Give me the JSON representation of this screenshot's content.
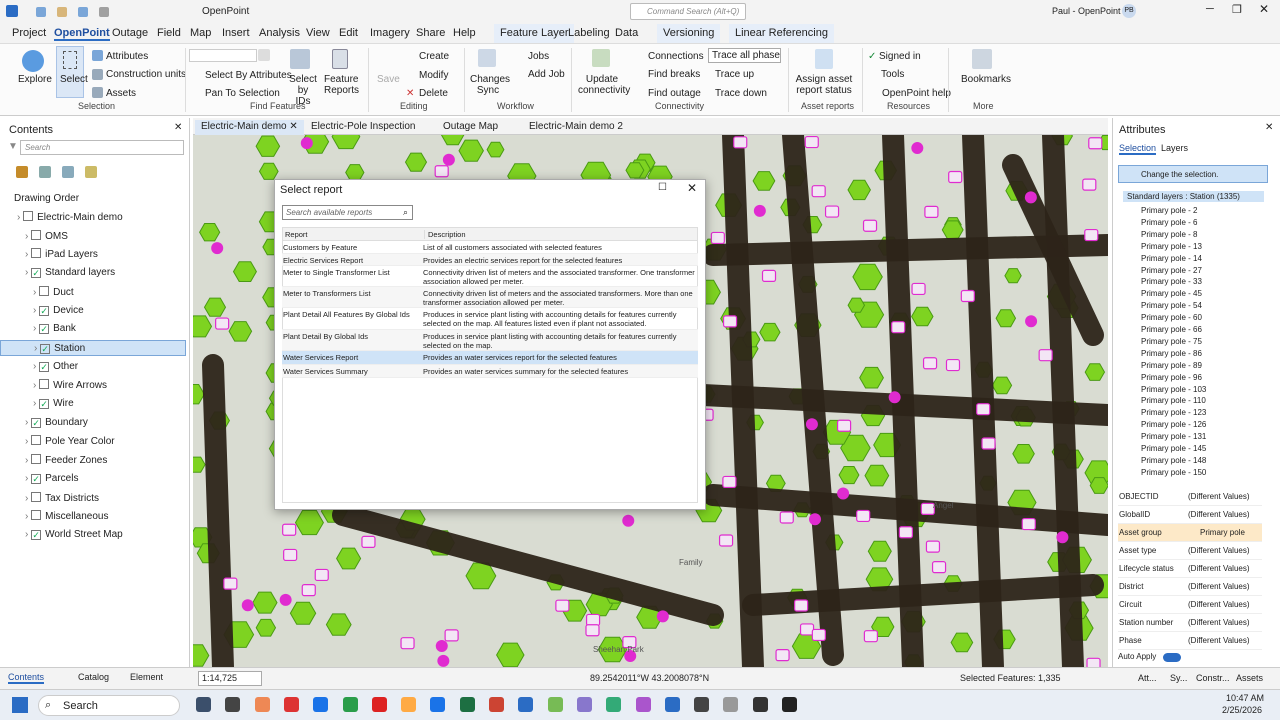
{
  "titlebar": {
    "undo_drop": "",
    "app": "OpenPoint",
    "search_placeholder": "Command Search (Alt+Q)",
    "user": "Paul - OpenPoint",
    "initials": "PB"
  },
  "menu": [
    "Project",
    "OpenPoint",
    "Outage",
    "Field",
    "Map",
    "Insert",
    "Analysis",
    "View",
    "Edit",
    "Imagery",
    "Share",
    "Help",
    "Feature Layer",
    "Labeling",
    "Data",
    "Versioning",
    "Linear Referencing"
  ],
  "ribbon": {
    "explore": "Explore",
    "select": "Select",
    "attributes": "Attributes",
    "construction_units": "Construction units",
    "assets": "Assets",
    "selection_group": "Selection",
    "select_by_attributes": "Select By Attributes",
    "pan_to_selection": "Pan To Selection",
    "select_by_ids": "Select by IDs",
    "feature_reports": "Feature Reports",
    "find_features_group": "Find Features",
    "save": "Save",
    "create": "Create",
    "modify": "Modify",
    "delete": "Delete",
    "editing_group": "Editing",
    "changes_sync": "Changes Sync",
    "jobs": "Jobs",
    "add_job": "Add Job",
    "workflow_group": "Workflow",
    "update_connectivity": "Update connectivity",
    "connections": "Connections",
    "find_breaks": "Find breaks",
    "find_outage": "Find outage",
    "trace_all_phases": "Trace all phase",
    "trace_up": "Trace up",
    "trace_down": "Trace down",
    "connectivity_group": "Connectivity",
    "assign_asset_report_status": "Assign asset report status",
    "asset_reports_group": "Asset reports",
    "signed_in": "Signed in",
    "tools": "Tools",
    "openpoint_help": "OpenPoint help",
    "resources_group": "Resources",
    "bookmarks": "Bookmarks",
    "more_group": "More"
  },
  "contents": {
    "title": "Contents",
    "search_placeholder": "Search",
    "drawing_order": "Drawing Order",
    "items": [
      {
        "label": "Electric-Main demo",
        "checked": false,
        "indent": 0
      },
      {
        "label": "OMS",
        "checked": false,
        "indent": 1
      },
      {
        "label": "iPad Layers",
        "checked": false,
        "indent": 1
      },
      {
        "label": "Standard layers",
        "checked": true,
        "indent": 1
      },
      {
        "label": "Duct",
        "checked": false,
        "indent": 2
      },
      {
        "label": "Device",
        "checked": true,
        "indent": 2
      },
      {
        "label": "Bank",
        "checked": true,
        "indent": 2
      },
      {
        "label": "Station",
        "checked": true,
        "indent": 2
      },
      {
        "label": "Other",
        "checked": true,
        "indent": 2
      },
      {
        "label": "Wire Arrows",
        "checked": false,
        "indent": 2
      },
      {
        "label": "Wire",
        "checked": true,
        "indent": 2
      },
      {
        "label": "Boundary",
        "checked": true,
        "indent": 1
      },
      {
        "label": "Pole Year Color",
        "checked": false,
        "indent": 1
      },
      {
        "label": "Feeder Zones",
        "checked": false,
        "indent": 1
      },
      {
        "label": "Parcels",
        "checked": true,
        "indent": 1
      },
      {
        "label": "Tax Districts",
        "checked": false,
        "indent": 1
      },
      {
        "label": "Miscellaneous",
        "checked": false,
        "indent": 1
      },
      {
        "label": "World Street Map",
        "checked": true,
        "indent": 1
      }
    ],
    "bottom_tabs": [
      "Contents",
      "Catalog",
      "Element"
    ]
  },
  "map_tabs": [
    "Electric-Main demo",
    "Electric-Pole Inspection",
    "Outage Map",
    "Electric-Main demo 2"
  ],
  "map_labels": [
    "Sheehan Park",
    "Family",
    "Angel"
  ],
  "dialog": {
    "title": "Select report",
    "search_placeholder": "Search available reports",
    "col_report": "Report",
    "col_description": "Description",
    "rows": [
      {
        "report": "Customers by Feature",
        "description": "List of all customers associated with selected features"
      },
      {
        "report": "Electric Services Report",
        "description": "Provides an electric services report for the selected features"
      },
      {
        "report": "Meter to Single Transformer List",
        "description": "Connectivity driven list of meters and the associated transformer. One transformer association allowed per meter."
      },
      {
        "report": "Meter to Transformers List",
        "description": "Connectivity driven list of meters and the associated transformers. More than one transformer association allowed per meter."
      },
      {
        "report": "Plant Detail All Features By Global Ids",
        "description": "Produces in service plant listing with accounting details for features currently selected on the map. All features listed even if plant not associated."
      },
      {
        "report": "Plant Detail By Global Ids",
        "description": "Produces in service plant listing with accounting details for features currently selected on the map."
      },
      {
        "report": "Water Services Report",
        "description": "Provides an water services report for the selected features"
      },
      {
        "report": "Water Services Summary",
        "description": "Provides an water services summary for the selected features"
      }
    ]
  },
  "attributes": {
    "title": "Attributes",
    "tab_selection": "Selection",
    "tab_layers": "Layers",
    "change_selection": "Change the selection.",
    "root": "Standard layers : Station (1335)",
    "poles": [
      "Primary pole - 2",
      "Primary pole - 6",
      "Primary pole - 8",
      "Primary pole - 13",
      "Primary pole - 14",
      "Primary pole - 27",
      "Primary pole - 33",
      "Primary pole - 45",
      "Primary pole - 54",
      "Primary pole - 60",
      "Primary pole - 66",
      "Primary pole - 75",
      "Primary pole - 86",
      "Primary pole - 89",
      "Primary pole - 96",
      "Primary pole - 103",
      "Primary pole - 110",
      "Primary pole - 123",
      "Primary pole - 126",
      "Primary pole - 131",
      "Primary pole - 145",
      "Primary pole - 148",
      "Primary pole - 150"
    ],
    "props": [
      {
        "name": "OBJECTID",
        "value": "(Different Values)"
      },
      {
        "name": "GlobalID",
        "value": "(Different Values)"
      },
      {
        "name": "Asset group",
        "value": "Primary pole"
      },
      {
        "name": "Asset type",
        "value": "(Different Values)"
      },
      {
        "name": "Lifecycle status",
        "value": "(Different Values)"
      },
      {
        "name": "District",
        "value": "(Different Values)"
      },
      {
        "name": "Circuit",
        "value": "(Different Values)"
      },
      {
        "name": "Station number",
        "value": "(Different Values)"
      },
      {
        "name": "Phase",
        "value": "(Different Values)"
      }
    ],
    "auto_apply": "Auto Apply",
    "bottom": [
      "Att...",
      "Sy...",
      "Constr...",
      "Assets"
    ]
  },
  "status": {
    "scale": "1:14,725",
    "coords": "89.2542011°W 43.2008078°N",
    "selected": "Selected Features: 1,335"
  },
  "taskbar": {
    "search": "Search",
    "time": "10:47 AM",
    "date": "2/25/2026"
  },
  "colors": {
    "accent": "#2b6cc4",
    "selected_row": "#cfe3f7",
    "pole_fill": "#2d2419",
    "hex_fill": "#7ed321",
    "highlight": "#e02bd0"
  }
}
